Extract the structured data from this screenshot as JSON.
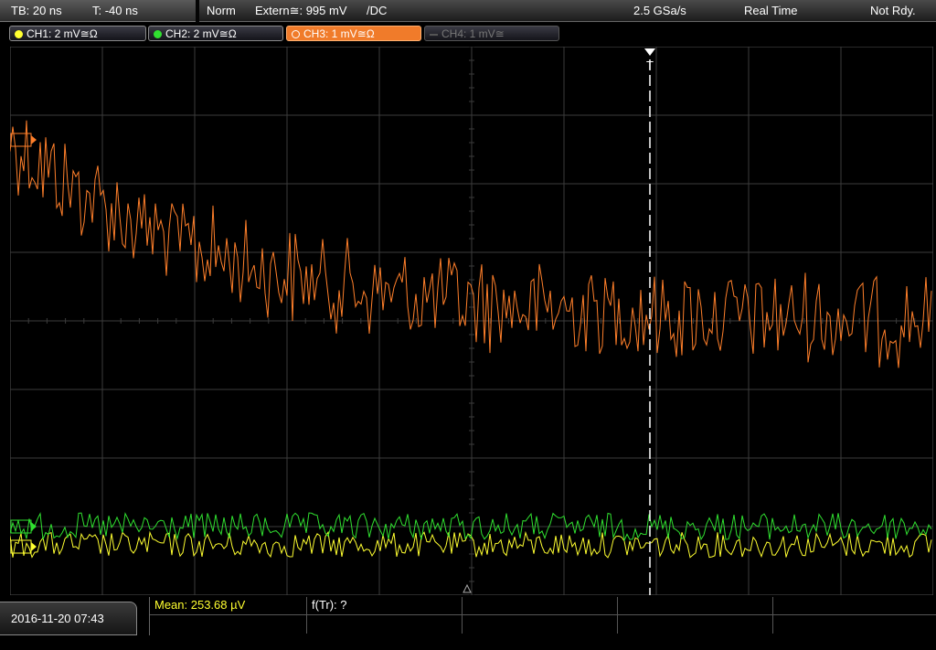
{
  "timebase": {
    "tb": "TB: 20 ns",
    "trigger_time": "T: -40 ns"
  },
  "status": {
    "mode": "Norm",
    "trigger_source": "Extern≅: 995 mV",
    "coupling": "/DC",
    "sample_rate": "2.5 GSa/s",
    "acq_mode": "Real Time",
    "state": "Not Rdy."
  },
  "channels": [
    {
      "label": "CH1: 2 mV≅Ω",
      "color": "#ffff30",
      "state": "on"
    },
    {
      "label": "CH2: 2 mV≅Ω",
      "color": "#30e030",
      "state": "on"
    },
    {
      "label": "CH3: 1 mV≅Ω",
      "color": "#ff7f2a",
      "state": "active"
    },
    {
      "label": "CH4: 1 mV≅",
      "color": "#666666",
      "state": "off"
    }
  ],
  "trigger_marker": "T",
  "bottom": {
    "datetime": "2016-11-20 07:43",
    "measurement1": "Mean: 253.68 µV",
    "measurement2": "f(Tr): ?"
  },
  "colors": {
    "grid": "#3c3c3c",
    "ch3": "#ff7f2a",
    "ch2": "#30e030",
    "ch1": "#ffff30"
  }
}
